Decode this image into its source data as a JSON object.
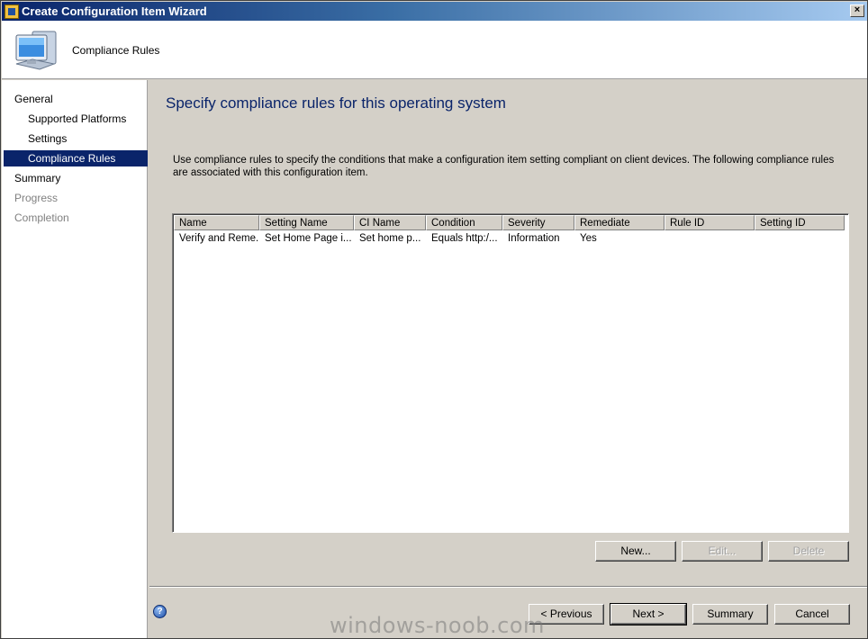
{
  "window": {
    "title": "Create Configuration Item Wizard",
    "close_glyph": "×"
  },
  "header": {
    "title": "Compliance Rules",
    "icon": "computer-monitor-icon"
  },
  "sidebar": {
    "items": [
      {
        "label": "General"
      },
      {
        "label": "Supported Platforms"
      },
      {
        "label": "Settings"
      },
      {
        "label": "Compliance Rules"
      },
      {
        "label": "Summary"
      },
      {
        "label": "Progress"
      },
      {
        "label": "Completion"
      }
    ]
  },
  "main": {
    "page_title": "Specify compliance rules for this operating system",
    "description": "Use compliance rules to specify the conditions that make a configuration item setting compliant on client devices. The following compliance rules are associated with this configuration item.",
    "table": {
      "columns": [
        "Name",
        "Setting Name",
        "CI Name",
        "Condition",
        "Severity",
        "Remediate",
        "Rule ID",
        "Setting ID"
      ],
      "rows": [
        [
          "Verify and Reme...",
          "Set Home Page i...",
          "Set home p...",
          "Equals http:/...",
          "Information",
          "Yes",
          "",
          ""
        ]
      ]
    },
    "buttons": {
      "new": "New...",
      "edit": "Edit...",
      "delete": "Delete"
    }
  },
  "footer": {
    "help_glyph": "?",
    "previous": "< Previous",
    "next": "Next >",
    "summary": "Summary",
    "cancel": "Cancel"
  },
  "watermark": "windows-noob.com",
  "colors": {
    "accent": "#0a246a",
    "title_text": "#0a246a",
    "dialog_bg": "#d4d0c8"
  }
}
